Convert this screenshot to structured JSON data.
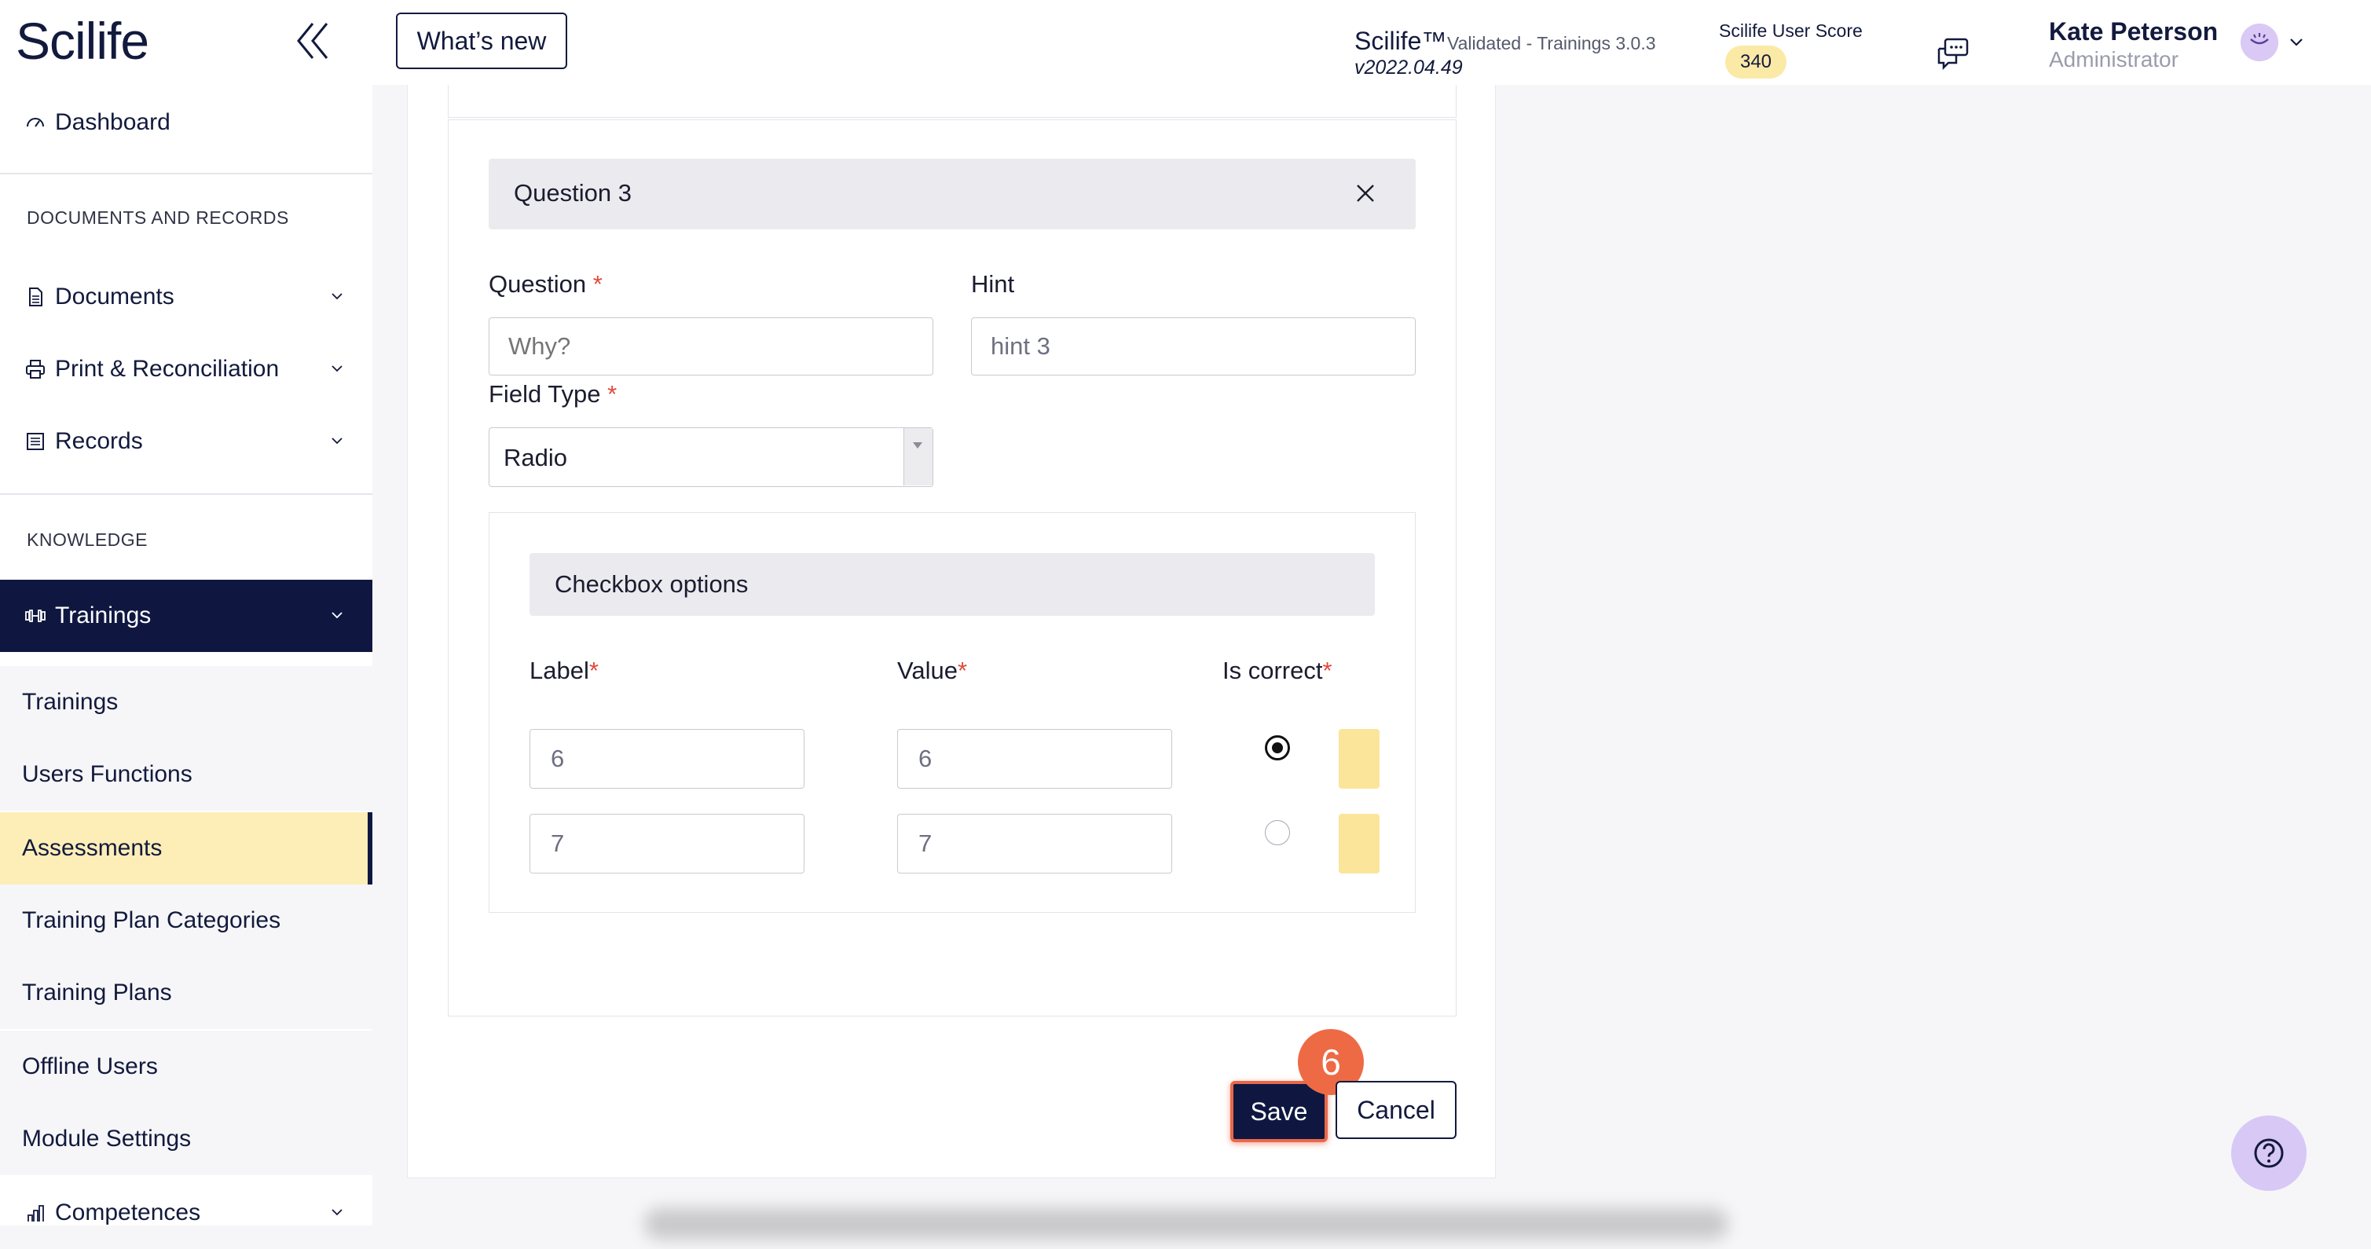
{
  "header": {
    "logo": "Scilife",
    "whats_new_label": "What’s new",
    "brand": "Scilife™",
    "validated": "Validated - Trainings 3.0.3",
    "version": "v2022.04.49",
    "score_label": "Scilife User Score",
    "score_value": "340",
    "user_name": "Kate Peterson",
    "user_role": "Administrator"
  },
  "sidebar": {
    "dashboard": "Dashboard",
    "section_documents": "DOCUMENTS AND RECORDS",
    "documents": "Documents",
    "print_reconciliation": "Print & Reconciliation",
    "records": "Records",
    "section_knowledge": "KNOWLEDGE",
    "trainings_group": "Trainings",
    "sub_items": [
      "Trainings",
      "Users Functions",
      "Assessments",
      "Training Plan Categories",
      "Training Plans",
      "Offline Users",
      "Module Settings"
    ],
    "competences": "Competences"
  },
  "form": {
    "question_title": "Question 3",
    "question_label": "Question",
    "question_placeholder": "Why?",
    "hint_label": "Hint",
    "hint_value": "hint 3",
    "field_type_label": "Field Type",
    "field_type_value": "Radio",
    "required_mark": "*",
    "options_title": "Checkbox options",
    "col_label": "Label",
    "col_value": "Value",
    "col_is_correct": "Is correct",
    "options": [
      {
        "label": "6",
        "value": "6",
        "correct": true
      },
      {
        "label": "7",
        "value": "7",
        "correct": false
      }
    ]
  },
  "actions": {
    "save_label": "Save",
    "cancel_label": "Cancel",
    "step_number": "6"
  },
  "colors": {
    "navy": "#0f1741",
    "accent_yellow": "#fdeeb8",
    "step_orange": "#ee6a45",
    "required_red": "#e0493d"
  }
}
